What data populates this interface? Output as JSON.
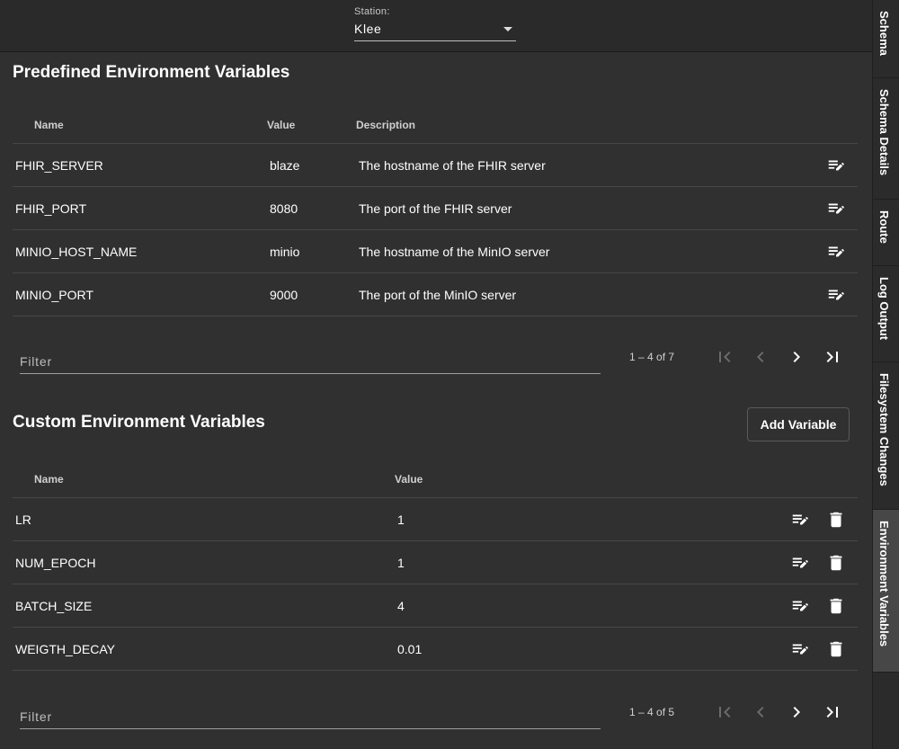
{
  "station": {
    "label": "Station:",
    "value": "Klee"
  },
  "predefined": {
    "title": "Predefined Environment Variables",
    "headers": {
      "name": "Name",
      "value": "Value",
      "description": "Description"
    },
    "rows": [
      {
        "name": "FHIR_SERVER",
        "value": "blaze",
        "description": "The hostname of the FHIR server"
      },
      {
        "name": "FHIR_PORT",
        "value": "8080",
        "description": "The port of the FHIR server"
      },
      {
        "name": "MINIO_HOST_NAME",
        "value": "minio",
        "description": "The hostname of the MinIO server"
      },
      {
        "name": "MINIO_PORT",
        "value": "9000",
        "description": "The port of the MinIO server"
      }
    ],
    "filter_placeholder": "Filter",
    "range": "1 – 4 of 7"
  },
  "custom": {
    "title": "Custom Environment Variables",
    "add_button": "Add Variable",
    "headers": {
      "name": "Name",
      "value": "Value"
    },
    "rows": [
      {
        "name": "LR",
        "value": "1"
      },
      {
        "name": "NUM_EPOCH",
        "value": "1"
      },
      {
        "name": "BATCH_SIZE",
        "value": "4"
      },
      {
        "name": "WEIGTH_DECAY",
        "value": "0.01"
      }
    ],
    "filter_placeholder": "Filter",
    "range": "1 – 4 of 5"
  },
  "sidetabs": [
    {
      "label": "Schema",
      "active": false
    },
    {
      "label": "Schema Details",
      "active": false
    },
    {
      "label": "Route",
      "active": false
    },
    {
      "label": "Log Output",
      "active": false
    },
    {
      "label": "Filesystem Changes",
      "active": false
    },
    {
      "label": "Environment Variables",
      "active": true
    }
  ],
  "icons": {
    "edit": "edit-note-icon",
    "delete": "trash-icon",
    "first": "first-page-icon",
    "prev": "chevron-left-icon",
    "next": "chevron-right-icon",
    "last": "last-page-icon",
    "dropdown": "caret-down-icon"
  },
  "colors": {
    "background": "#303030",
    "topbar": "#2a2a2a",
    "divider": "#474747",
    "active_tab": "#474747"
  }
}
